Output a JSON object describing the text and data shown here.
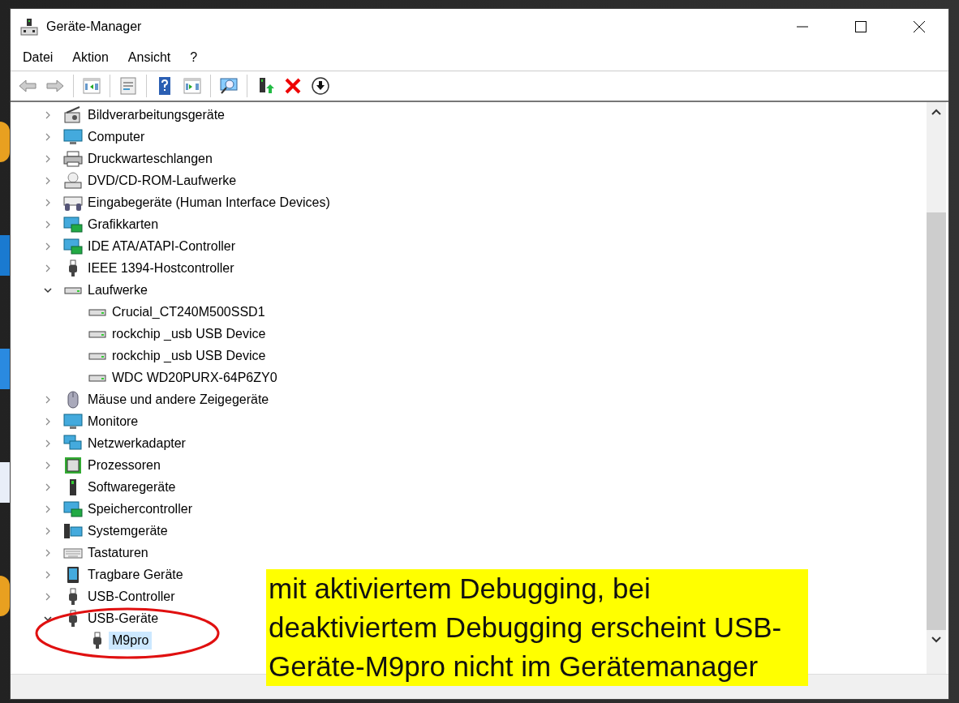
{
  "window": {
    "title": "Geräte-Manager"
  },
  "menu": [
    "Datei",
    "Aktion",
    "Ansicht",
    "?"
  ],
  "tree": [
    {
      "label": "Bildverarbeitungsgeräte",
      "expanded": false,
      "selected": false
    },
    {
      "label": "Computer",
      "expanded": false,
      "selected": false
    },
    {
      "label": "Druckwarteschlangen",
      "expanded": false,
      "selected": false
    },
    {
      "label": "DVD/CD-ROM-Laufwerke",
      "expanded": false,
      "selected": false
    },
    {
      "label": "Eingabegeräte (Human Interface Devices)",
      "expanded": false,
      "selected": false
    },
    {
      "label": "Grafikkarten",
      "expanded": false,
      "selected": false
    },
    {
      "label": "IDE ATA/ATAPI-Controller",
      "expanded": false,
      "selected": false
    },
    {
      "label": "IEEE 1394-Hostcontroller",
      "expanded": false,
      "selected": false
    },
    {
      "label": "Laufwerke",
      "expanded": true,
      "selected": false,
      "children": [
        {
          "label": "Crucial_CT240M500SSD1",
          "selected": false
        },
        {
          "label": "rockchip _usb USB Device",
          "selected": false
        },
        {
          "label": "rockchip _usb USB Device",
          "selected": false
        },
        {
          "label": "WDC WD20PURX-64P6ZY0",
          "selected": false
        }
      ]
    },
    {
      "label": "Mäuse und andere Zeigegeräte",
      "expanded": false,
      "selected": false
    },
    {
      "label": "Monitore",
      "expanded": false,
      "selected": false
    },
    {
      "label": "Netzwerkadapter",
      "expanded": false,
      "selected": false
    },
    {
      "label": "Prozessoren",
      "expanded": false,
      "selected": false
    },
    {
      "label": "Softwaregeräte",
      "expanded": false,
      "selected": false
    },
    {
      "label": "Speichercontroller",
      "expanded": false,
      "selected": false
    },
    {
      "label": "Systemgeräte",
      "expanded": false,
      "selected": false
    },
    {
      "label": "Tastaturen",
      "expanded": false,
      "selected": false
    },
    {
      "label": "Tragbare Geräte",
      "expanded": false,
      "selected": false
    },
    {
      "label": "USB-Controller",
      "expanded": false,
      "selected": false
    },
    {
      "label": "USB-Geräte",
      "expanded": true,
      "selected": false,
      "children": [
        {
          "label": "M9pro",
          "selected": true
        }
      ]
    }
  ],
  "annotation": {
    "text": "mit aktiviertem Debugging, bei deaktiviertem Debugging erscheint USB-Geräte-M9pro nicht im Gerätemanager"
  }
}
